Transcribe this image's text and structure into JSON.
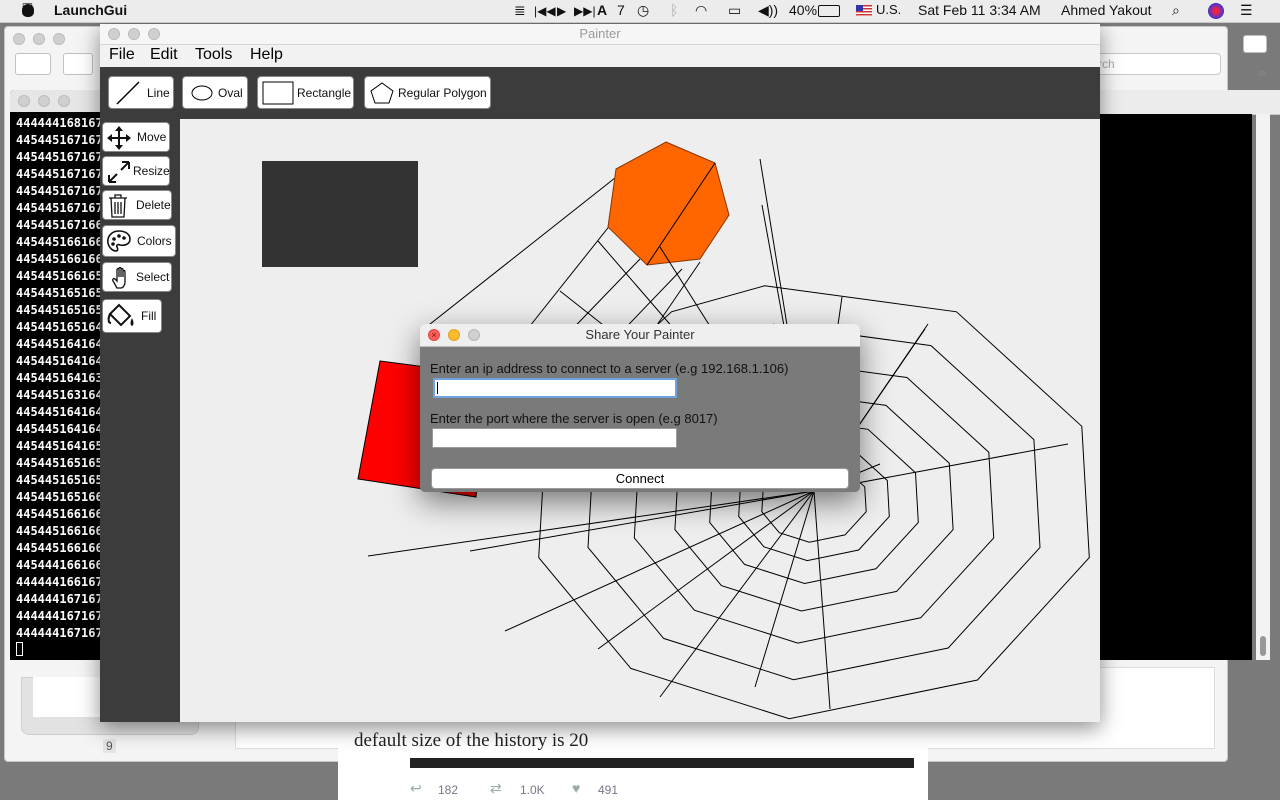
{
  "menubar": {
    "app_name": "LaunchGui",
    "keyboard_badge": "7",
    "battery": "40%",
    "input_source": "U.S.",
    "datetime": "Sat Feb 11  3:34 AM",
    "user": "Ahmed Yakout"
  },
  "background": {
    "search_placeholder": "rch",
    "page_number": "9",
    "article_text": "default size of the history is 20",
    "tweet_stats": {
      "replies": "182",
      "retweets": "1.0K",
      "likes": "491"
    }
  },
  "terminal": {
    "lines": [
      "444444168167",
      "445445167167",
      "445445167167",
      "445445167167",
      "445445167167",
      "445445167167",
      "445445167166",
      "445445166166",
      "445445166166",
      "445445166165",
      "445445165165",
      "445445165165",
      "445445165164",
      "445445164164",
      "445445164164",
      "445445164163",
      "445445163164",
      "445445164164",
      "445445164164",
      "445445164165",
      "445445165165",
      "445445165165",
      "445445165166",
      "445445166166",
      "445445166166",
      "445445166166",
      "445444166166",
      "444444166167",
      "444444167167",
      "444444167167",
      "444444167167"
    ]
  },
  "painter": {
    "title": "Painter",
    "menu": [
      "File",
      "Edit",
      "Tools",
      "Help"
    ],
    "shape_tools": {
      "line": "Line",
      "oval": "Oval",
      "rectangle": "Rectangle",
      "polygon": "Regular Polygon"
    },
    "side_tools": {
      "move": "Move",
      "resize": "Resize",
      "delete": "Delete",
      "colors": "Colors",
      "select": "Select",
      "fill": "Fill"
    },
    "colors": {
      "panel": "#3c3c3c",
      "canvas": "#eeeeee",
      "orange": "#ff6600",
      "red": "#ff0000",
      "dark_rect": "#333333"
    }
  },
  "dialog": {
    "title": "Share Your Painter",
    "ip_label": "Enter an ip address to connect to a server (e.g 192.168.1.106)",
    "ip_value": "",
    "port_label": "Enter the port where the server is open (e.g 8017)",
    "port_value": "",
    "connect_label": "Connect"
  }
}
